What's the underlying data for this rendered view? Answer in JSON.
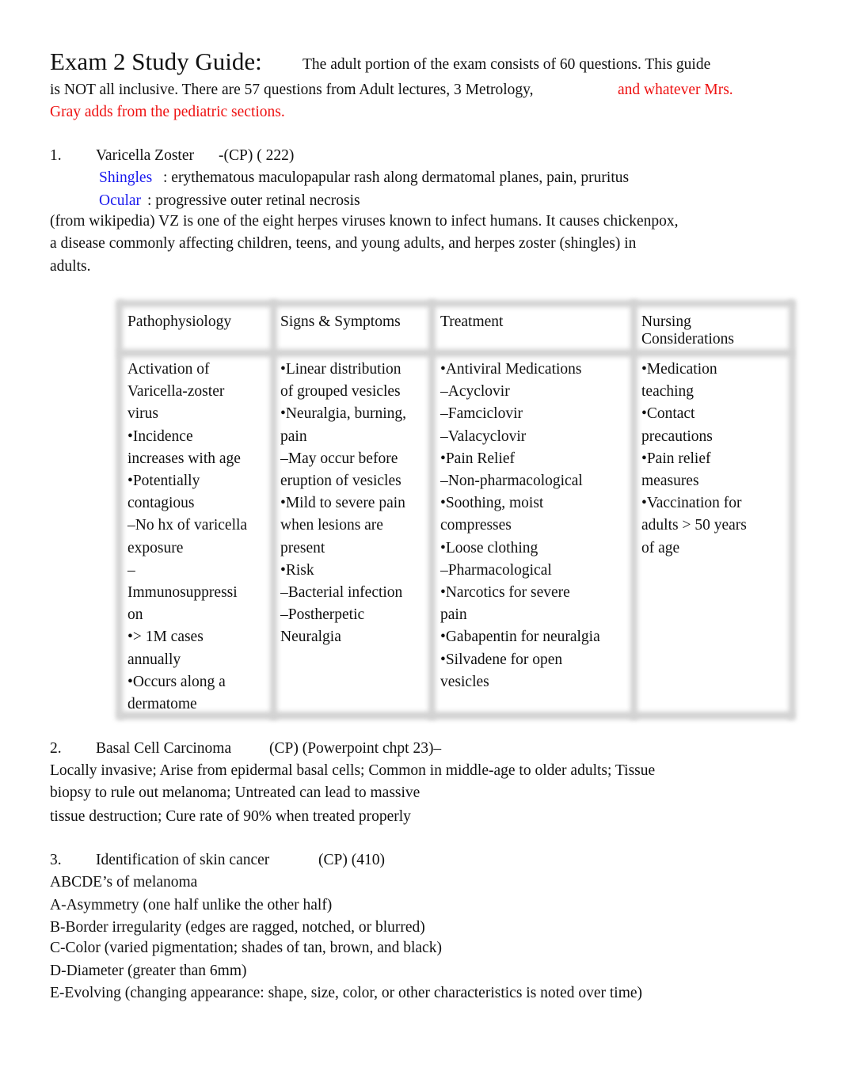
{
  "header": {
    "title": "Exam 2 Study Guide:",
    "intro_line1": "The  adult  portion of the exam consists of 60 questions. This guide",
    "intro_line2": "is NOT all inclusive.    There are 57 questions from Adult lectures, 3 Metrology,",
    "intro_red_1": "and whatever Mrs.",
    "intro_red_2": "Gray adds from the pediatric sections."
  },
  "section1": {
    "number": "1.",
    "title": "Varicella Zoster",
    "ref": "-(CP) ( 222)",
    "shingles_label": "Shingles",
    "shingles_text": ": erythematous maculopapular rash along dermatomal planes, pain, pruritus",
    "ocular_label": "Ocular",
    "ocular_text": ": progressive outer retinal necrosis",
    "paragraph": [
      "(from wikipedia) VZ is one of the eight herpes viruses known to infect humans. It causes chickenpox,",
      "a disease commonly affecting children, teens, and young adults, and herpes zoster (shingles) in",
      "adults."
    ],
    "table": {
      "headers": [
        "Pathophysiology",
        "Signs & Symptoms",
        "Treatment",
        "Nursing\nConsiderations"
      ],
      "columns": [
        [
          "Activation of",
          "Varicella-zoster",
          "virus",
          "•Incidence",
          "increases with age",
          "•Potentially",
          "contagious",
          "–No hx of varicella",
          "exposure",
          "–",
          "Immunosuppressi",
          "on",
          "•> 1M cases",
          "annually",
          "•Occurs along a",
          "dermatome"
        ],
        [
          "•Linear distribution",
          "of grouped vesicles",
          "•Neuralgia, burning,",
          "pain",
          "–May occur before",
          "eruption of vesicles",
          "•Mild to severe pain",
          "when lesions are",
          "present",
          "•Risk",
          "–Bacterial infection",
          "–Postherpetic",
          "Neuralgia"
        ],
        [
          "•Antiviral Medications",
          "–Acyclovir",
          "–Famciclovir",
          "–Valacyclovir",
          "•Pain Relief",
          "–Non-pharmacological",
          "•Soothing, moist",
          "compresses",
          "•Loose clothing",
          "–Pharmacological",
          "•Narcotics for severe",
          "pain",
          "•Gabapentin for neuralgia",
          "•Silvadene for open",
          "vesicles"
        ],
        [
          "•Medication",
          "teaching",
          "•Contact",
          "precautions",
          "•Pain relief",
          "measures",
          "•Vaccination for",
          "adults > 50 years",
          "of age"
        ]
      ]
    }
  },
  "section2": {
    "number": "2.",
    "title": "Basal Cell Carcinoma",
    "ref": "(CP) (Powerpoint chpt 23)–",
    "lines": [
      "Locally invasive; Arise from epidermal basal cells; Common in middle-age to older adults; Tissue",
      "biopsy to rule out melanoma; Untreated can lead to massive",
      "tissue destruction; Cure rate of 90% when treated properly"
    ]
  },
  "section3": {
    "number": "3.",
    "title": "Identification of skin cancer",
    "ref": "(CP) (410)",
    "lines": [
      "ABCDE’s of melanoma",
      "A-Asymmetry (one half unlike the other half)",
      "B-Border irregularity (edges are ragged, notched, or blurred)",
      "C-Color (varied pigmentation; shades of tan, brown, and black)",
      "D-Diameter (greater than 6mm)",
      "E-Evolving (changing appearance: shape, size, color, or other characteristics is noted over time)"
    ]
  },
  "colors": {
    "red": "#ee1111",
    "blue": "#1a1aee",
    "text": "#111111",
    "gridline": "#d2d2d2"
  }
}
